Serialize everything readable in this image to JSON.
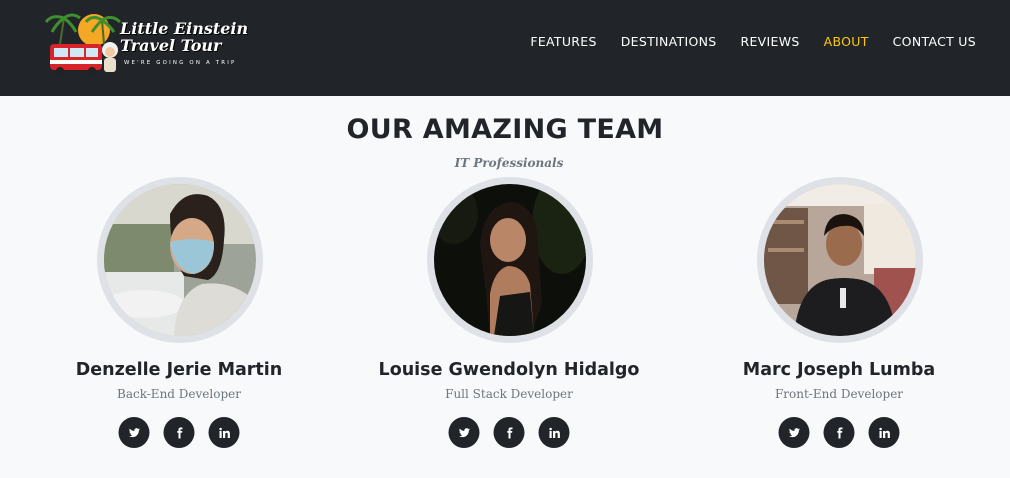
{
  "navbar": {
    "brand_title_line1": "Little Einstein",
    "brand_title_line2": "Travel Tour",
    "brand_tagline": "WE'RE GOING ON A TRIP",
    "links": [
      {
        "label": "FEATURES",
        "active": false
      },
      {
        "label": "DESTINATIONS",
        "active": false
      },
      {
        "label": "REVIEWS",
        "active": false
      },
      {
        "label": "ABOUT",
        "active": true
      },
      {
        "label": "CONTACT US",
        "active": false
      }
    ],
    "active_color": "#fec810"
  },
  "team": {
    "heading": "OUR AMAZING TEAM",
    "subheading": "IT Professionals",
    "members": [
      {
        "name": "Denzelle Jerie Martin",
        "role": "Back-End Developer"
      },
      {
        "name": "Louise Gwendolyn Hidalgo",
        "role": "Full Stack Developer"
      },
      {
        "name": "Marc Joseph Lumba",
        "role": "Front-End Developer"
      }
    ],
    "social_icons": [
      "twitter-icon",
      "facebook-icon",
      "linkedin-icon"
    ]
  }
}
